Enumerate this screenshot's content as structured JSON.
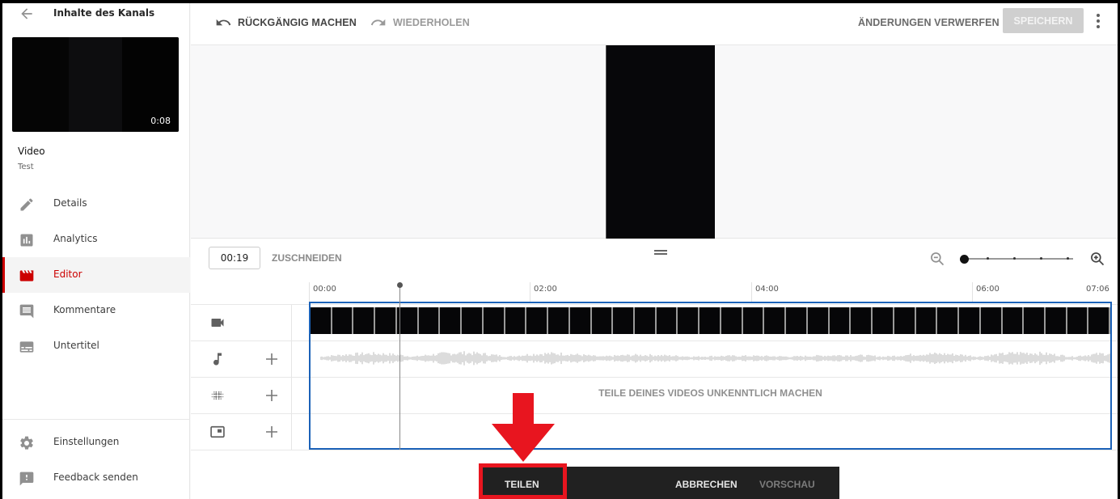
{
  "sidebar": {
    "back_label": "Inhalte des Kanals",
    "thumbnail": {
      "duration": "0:08"
    },
    "video_label": "Video",
    "video_title": "Test",
    "items": [
      {
        "label": "Details",
        "icon": "pencil-icon",
        "active": false
      },
      {
        "label": "Analytics",
        "icon": "bar-chart-icon",
        "active": false
      },
      {
        "label": "Editor",
        "icon": "clapperboard-icon",
        "active": true
      },
      {
        "label": "Kommentare",
        "icon": "comment-icon",
        "active": false
      },
      {
        "label": "Untertitel",
        "icon": "subtitles-icon",
        "active": false
      }
    ],
    "footer_items": [
      {
        "label": "Einstellungen",
        "icon": "gear-icon"
      },
      {
        "label": "Feedback senden",
        "icon": "feedback-icon"
      }
    ]
  },
  "toolbar": {
    "undo_label": "RÜCKGÄNGIG MACHEN",
    "redo_label": "WIEDERHOLEN",
    "discard_label": "ÄNDERUNGEN VERWERFEN",
    "save_label": "SPEICHERN"
  },
  "timeline_toolbar": {
    "current_time": "00:19",
    "trim_label": "ZUSCHNEIDEN",
    "zoom_level_steps": 5,
    "zoom_level_current": 0
  },
  "timeline": {
    "ticks": [
      "00:00",
      "02:00",
      "04:00",
      "06:00",
      "07:06"
    ],
    "playhead_time": "00:19",
    "total_duration": "07:06",
    "tracks": [
      {
        "name": "video",
        "icon": "video-camera-icon",
        "addable": false
      },
      {
        "name": "audio",
        "icon": "music-note-icon",
        "addable": true
      },
      {
        "name": "blur",
        "icon": "blur-icon",
        "addable": true,
        "label": "TEILE DEINES VIDEOS UNKENNTLICH MACHEN"
      },
      {
        "name": "endscreen",
        "icon": "end-screen-icon",
        "addable": true
      }
    ]
  },
  "bottom_bar": {
    "split_label": "TEILEN",
    "cancel_label": "ABBRECHEN",
    "preview_label": "VORSCHAU"
  },
  "colors": {
    "accent_red": "#cc0000",
    "selection_blue": "#1b62b8",
    "annotation_red": "#e8151f"
  }
}
